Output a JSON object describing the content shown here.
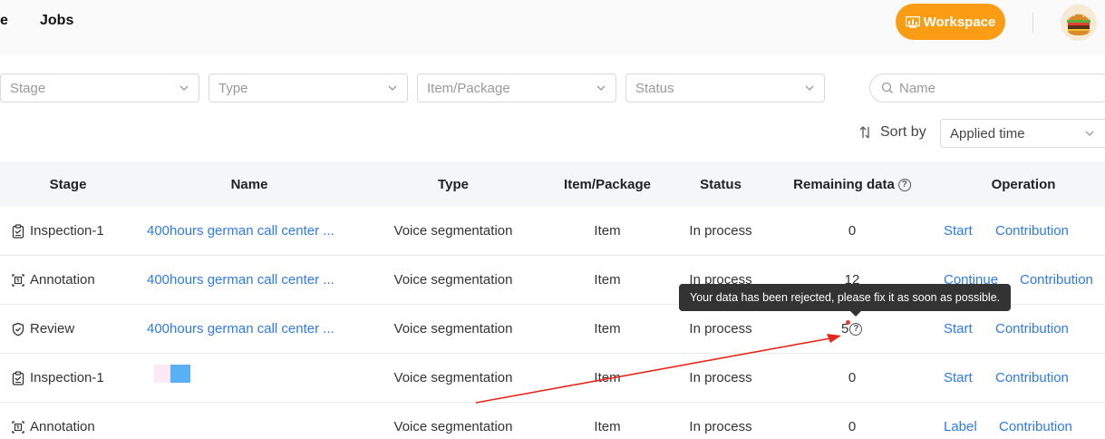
{
  "header": {
    "nav_partial": "e",
    "nav_jobs": "Jobs",
    "workspace_label": "Workspace",
    "accent_color": "#fb9d14"
  },
  "filters": {
    "stage_placeholder": "Stage",
    "type_placeholder": "Type",
    "item_package_placeholder": "Item/Package",
    "status_placeholder": "Status",
    "search_placeholder": "Name"
  },
  "sort": {
    "label": "Sort by",
    "value": "Applied time"
  },
  "table": {
    "headers": {
      "stage": "Stage",
      "name": "Name",
      "type": "Type",
      "item_package": "Item/Package",
      "status": "Status",
      "remaining": "Remaining data",
      "operation": "Operation"
    },
    "rows": [
      {
        "stage": "Inspection-1",
        "stage_icon": "clipboard-check-icon",
        "name": "400hours german call center ...",
        "type": "Voice segmentation",
        "item_package": "Item",
        "status": "In process",
        "remaining": "0",
        "op1": "Start",
        "op2": "Contribution"
      },
      {
        "stage": "Annotation",
        "stage_icon": "annotation-frame-icon",
        "name": "400hours german call center ...",
        "type": "Voice segmentation",
        "item_package": "Item",
        "status": "In process",
        "remaining": "12",
        "op1": "Continue",
        "op2": "Contribution"
      },
      {
        "stage": "Review",
        "stage_icon": "shield-check-icon",
        "name": "400hours german call center ...",
        "type": "Voice segmentation",
        "item_package": "Item",
        "status": "In process",
        "remaining": "5",
        "op1": "Start",
        "op2": "Contribution"
      },
      {
        "stage": "Inspection-1",
        "stage_icon": "clipboard-check-icon",
        "name": "",
        "type": "Voice segmentation",
        "item_package": "Item",
        "status": "In process",
        "remaining": "0",
        "op1": "Start",
        "op2": "Contribution"
      },
      {
        "stage": "Annotation",
        "stage_icon": "annotation-frame-icon",
        "name": "",
        "type": "Voice segmentation",
        "item_package": "Item",
        "status": "In process",
        "remaining": "0",
        "op1": "Label",
        "op2": "Contribution"
      }
    ]
  },
  "tooltip": {
    "text": "Your data has been rejected, please fix it as soon as possible."
  }
}
